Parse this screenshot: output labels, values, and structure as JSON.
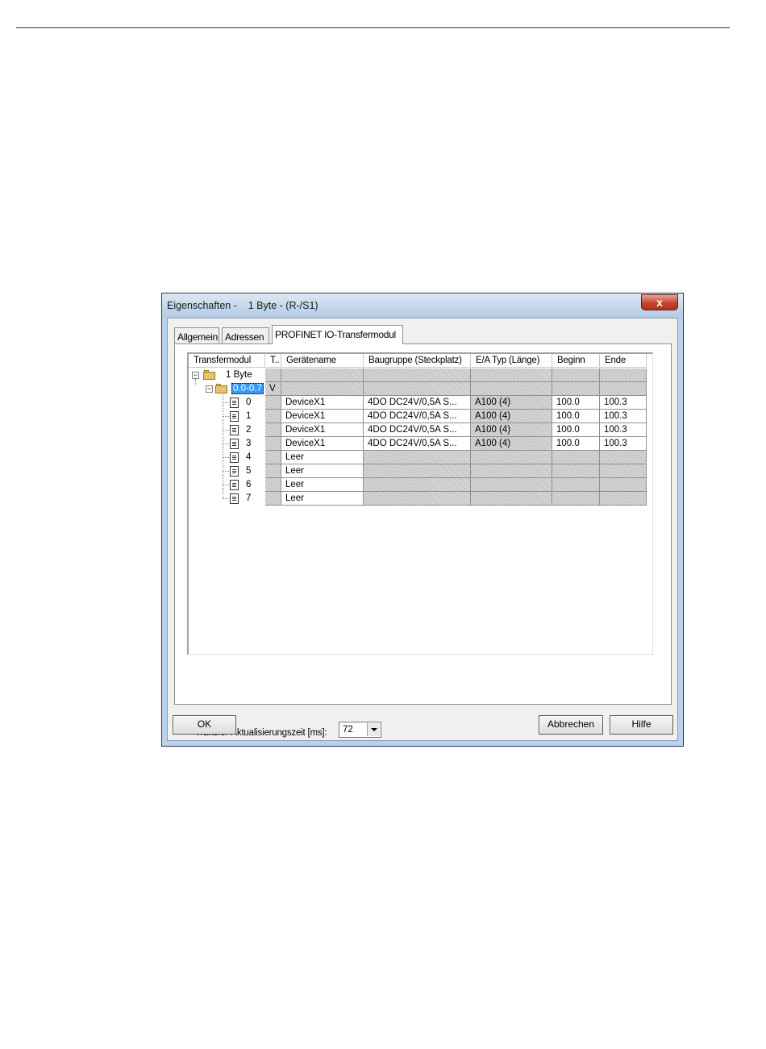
{
  "window": {
    "title": "Eigenschaften -    1 Byte - (R-/S1)",
    "close_glyph": "x"
  },
  "tabs": [
    {
      "label": "Allgemein"
    },
    {
      "label": "Adressen"
    },
    {
      "label": "PROFINET IO-Transfermodul"
    }
  ],
  "table": {
    "headers": [
      "Transfermodul",
      "T..",
      "Gerätename",
      "Baugruppe (Steckplatz)",
      "E/A Typ (Länge)",
      "Beginn",
      "Ende"
    ],
    "root": {
      "label": "1 Byte"
    },
    "group": {
      "label": "0.0-0.7",
      "t": "V"
    },
    "rows": [
      {
        "label": "0",
        "device": "DeviceX1",
        "module": "4DO DC24V/0,5A S...",
        "type": "A100 (4)",
        "begin": "100.0",
        "end": "100.3"
      },
      {
        "label": "1",
        "device": "DeviceX1",
        "module": "4DO DC24V/0,5A S...",
        "type": "A100 (4)",
        "begin": "100.0",
        "end": "100.3"
      },
      {
        "label": "2",
        "device": "DeviceX1",
        "module": "4DO DC24V/0,5A S...",
        "type": "A100 (4)",
        "begin": "100.0",
        "end": "100.3"
      },
      {
        "label": "3",
        "device": "DeviceX1",
        "module": "4DO DC24V/0,5A S...",
        "type": "A100 (4)",
        "begin": "100.0",
        "end": "100.3"
      },
      {
        "label": "4",
        "device": "Leer",
        "module": "",
        "type": "",
        "begin": "",
        "end": ""
      },
      {
        "label": "5",
        "device": "Leer",
        "module": "",
        "type": "",
        "begin": "",
        "end": ""
      },
      {
        "label": "6",
        "device": "Leer",
        "module": "",
        "type": "",
        "begin": "",
        "end": ""
      },
      {
        "label": "7",
        "device": "Leer",
        "module": "",
        "type": "",
        "begin": "",
        "end": ""
      }
    ]
  },
  "update_time": {
    "label": "Transfer-Aktualisierungszeit [ms]:",
    "value": "72"
  },
  "buttons": {
    "ok": "OK",
    "cancel": "Abbrechen",
    "help": "Hilfe"
  }
}
